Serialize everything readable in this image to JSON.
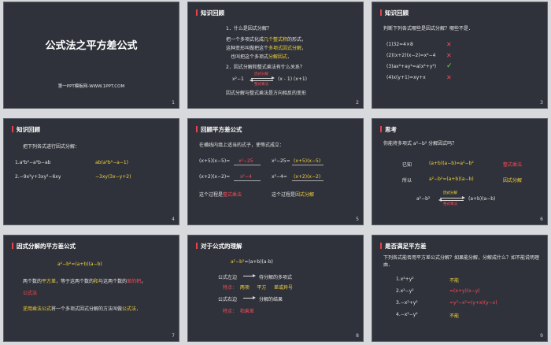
{
  "s1": {
    "title": "公式法之平方差公式",
    "sub": "第一PPT模板网-WWW.1PPT.COM",
    "num": "1"
  },
  "s2": {
    "hdr": "知识回顾",
    "q1": "1．什么是因式分解？",
    "l1a": "把一个多项式化成",
    "l1b": "几个整式积",
    "l1c": "的形式，",
    "l2a": "这种变形叫做把这个",
    "l2b": "多项式因式分解",
    "l2c": "，",
    "l3a": "也叫把这个多项式",
    "l3b": "分解因式",
    "l3c": "．",
    "q2": "2．因式分解和整式乘法有什么关系？",
    "e1": "x²−1",
    "e2": "(x - 1) (x+1)",
    "top": "因式分解",
    "bot": "整式乘法",
    "concl": "因式分解与整式乘法是方向相反的变形",
    "num": "2"
  },
  "s3": {
    "hdr": "知识回顾",
    "intro": "判断下列各式哪些是因式分解？哪些不是．",
    "items": [
      {
        "t": "(1)32=4×8",
        "m": "✕"
      },
      {
        "t": "(2)(x+2)(x−2)=x²−4",
        "m": "✕"
      },
      {
        "t": "(3)ax²+ay²=a(x²+y²)",
        "m": "✓"
      },
      {
        "t": "(4)x(y+1)=xy+x",
        "m": "✕"
      }
    ],
    "num": "3"
  },
  "s4": {
    "hdr": "知识回顾",
    "intro": "把下列各式进行因式分解：",
    "p1": "1.a²b²−a²b−ab",
    "a1": "ab(a²b²−a−1)",
    "p2": "2.−9x²y+3xy²−6xy",
    "a2": "−3xy(3x−y+2)",
    "num": "4"
  },
  "s5": {
    "hdr": "回顾平方差公式",
    "intro": "在横线内填上适当的式子，使等式成立：",
    "r1a": "(x+5)(x−5)=",
    "r1b": "x²−25",
    "r1c": "x²−25=",
    "r1d": "(x+5)(x−5)",
    "r2a": "(x+2)(x−2)=",
    "r2b": "x²−4",
    "r2c": "x²−4=",
    "r2d": "(x+2)(x−2)",
    "c1": "这个过程是",
    "c1b": "整式乘法",
    "c2": "这个过程是",
    "c2b": "因式分解",
    "num": "5"
  },
  "s6": {
    "hdr": "思考",
    "intro": "你能将多项式 a²−b² 分解因式吗？",
    "k1": "已知",
    "f1": "(a+b)(a−b)=a²−b²",
    "n1": "整式乘法",
    "k2": "所以",
    "f2": "a²−b²=(a+b)(a−b)",
    "n2": "因式分解",
    "ea": "a²−b²",
    "eb": "(a+b)(a−b)",
    "top": "因式分解",
    "bot": "整式乘法",
    "num": "6"
  },
  "s7": {
    "hdr": "因式分解的平方差公式",
    "f": "a²−b²=(a+b)(a−b)",
    "l1a": "两个数的",
    "l1b": "平方差",
    "l1c": "，等于这两个数的",
    "l1d": "和",
    "l1e": "与这两个数的",
    "l1f": "差的积",
    "l1g": "，",
    "l2": "公式法",
    "l3a": "逆用乘法公式",
    "l3b": "将一个多项式因式分解的方法叫做",
    "l3c": "公式法",
    "l3d": "．",
    "num": "7"
  },
  "s8": {
    "hdr": "对于公式的理解",
    "fa": "a²−b²",
    "fb": "=(a+b)(a-b)",
    "k1": "公式左边",
    "v1": "待分解的多项式",
    "s1": "特点：",
    "s1a": "两项",
    "s1b": "平方",
    "s1c": "差或异号",
    "k2": "公式右边",
    "v2": "分解的结果",
    "s2": "特点：",
    "s2a": "和乘差",
    "num": "8"
  },
  "s9": {
    "hdr": "是否满足平方差",
    "intro": "下列各式能否用平方差公式分解？如果能分解，分解成什么？如不能说明理由．",
    "items": [
      {
        "t": "1.x²+y²",
        "a": "不能",
        "ay": true
      },
      {
        "t": "2.x²−y²",
        "a": "=(x+y)(x−y)",
        "ay": false
      },
      {
        "t": "3.−x²+y²",
        "a": "=y²−x²=(y+x)(y−x)",
        "ay": false
      },
      {
        "t": "4.−x²−y²",
        "a": "不能",
        "ay": true
      }
    ],
    "num": "9"
  }
}
